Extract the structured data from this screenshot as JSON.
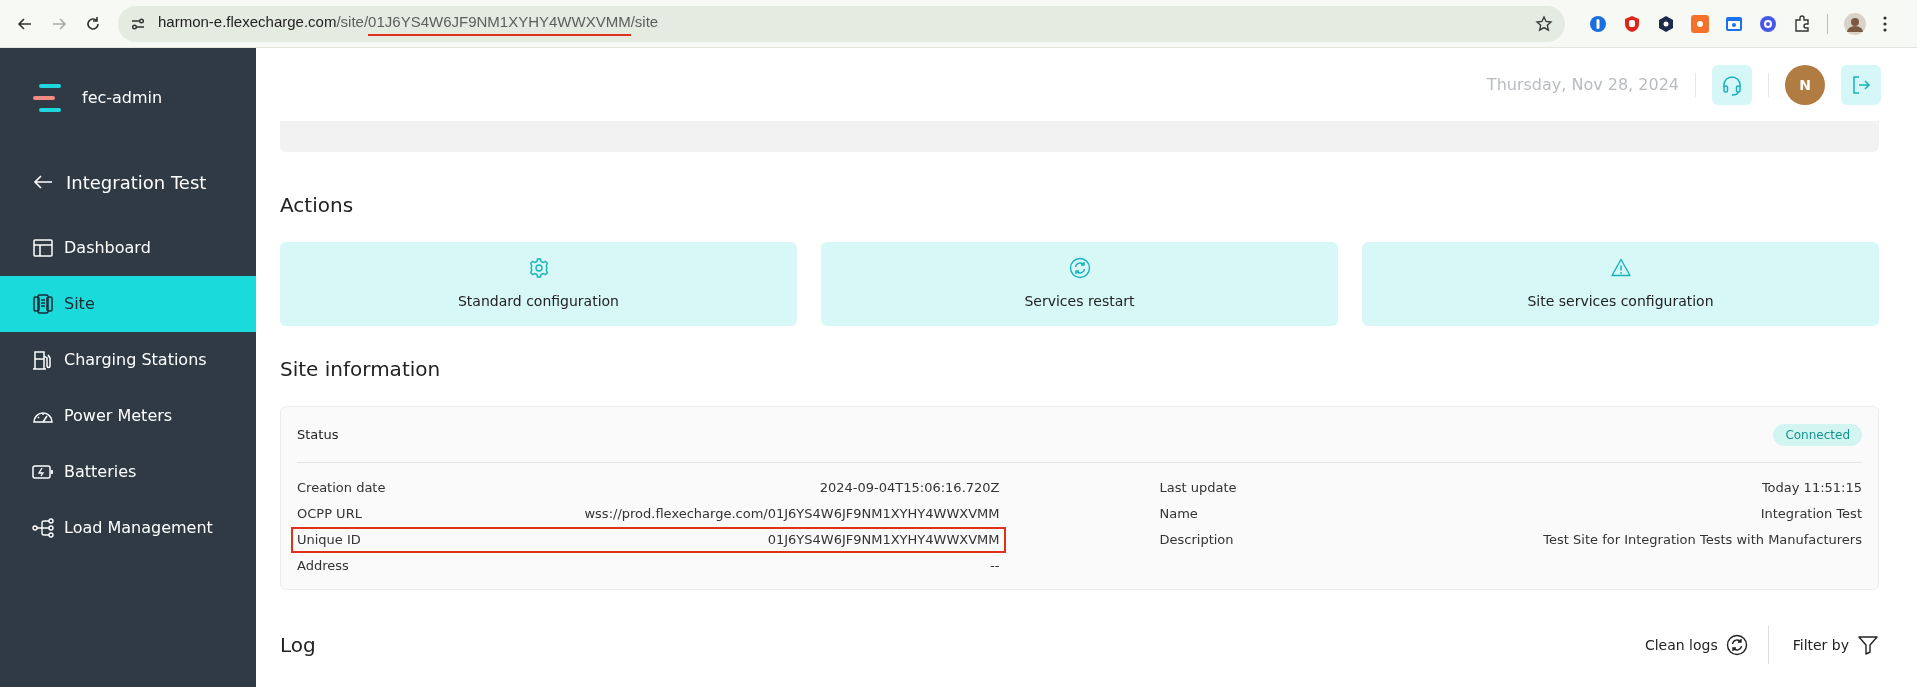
{
  "browser": {
    "url_parts": [
      {
        "text": "harmon-e.flexecharge.com",
        "kind": "host",
        "underlined": false
      },
      {
        "text": "/site/",
        "kind": "path",
        "underlined": false
      },
      {
        "text": "01J6YS4W6JF9NM1XYHY4WWXVMM",
        "kind": "path",
        "underlined": true
      },
      {
        "text": "/site",
        "kind": "path",
        "underlined": false
      }
    ]
  },
  "sidebar": {
    "app_name": "fec-admin",
    "back_label": "Integration Test",
    "items": [
      {
        "label": "Dashboard",
        "selected": false
      },
      {
        "label": "Site",
        "selected": true
      },
      {
        "label": "Charging Stations",
        "selected": false
      },
      {
        "label": "Power Meters",
        "selected": false
      },
      {
        "label": "Batteries",
        "selected": false
      },
      {
        "label": "Load Management",
        "selected": false
      }
    ]
  },
  "header": {
    "date": "Thursday, Nov 28, 2024",
    "avatar": "N"
  },
  "actions": {
    "title": "Actions",
    "items": [
      {
        "label": "Standard configuration"
      },
      {
        "label": "Services restart"
      },
      {
        "label": "Site services configuration"
      }
    ]
  },
  "site_information": {
    "title": "Site information",
    "status_label": "Status",
    "status": "Connected",
    "left": [
      {
        "label": "Creation date",
        "value": "2024-09-04T15:06:16.720Z",
        "highlighted": false
      },
      {
        "label": "OCPP URL",
        "value": "wss://prod.flexecharge.com/01J6YS4W6JF9NM1XYHY4WWXVMM",
        "highlighted": false
      },
      {
        "label": "Unique ID",
        "value": "01J6YS4W6JF9NM1XYHY4WWXVMM",
        "highlighted": true
      },
      {
        "label": "Address",
        "value": "--",
        "highlighted": false
      }
    ],
    "right": [
      {
        "label": "Last update",
        "value": "Today 11:51:15"
      },
      {
        "label": "Name",
        "value": "Integration Test"
      },
      {
        "label": "Description",
        "value": "Test Site for Integration Tests with Manufacturers"
      }
    ]
  },
  "log": {
    "title": "Log",
    "clean_label": "Clean logs",
    "filter_label": "Filter by"
  }
}
